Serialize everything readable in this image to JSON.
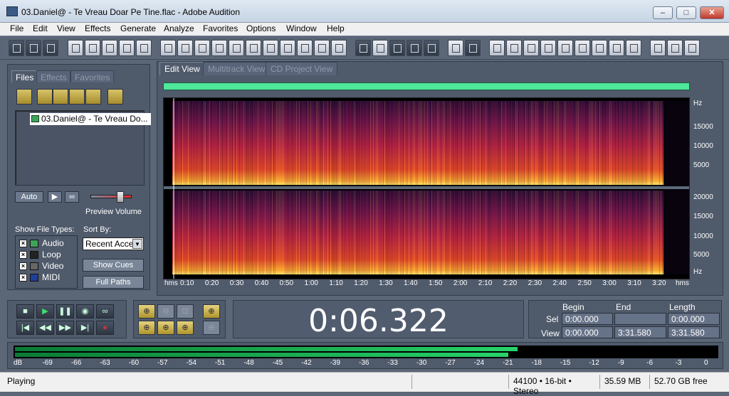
{
  "window": {
    "title": "03.Daniel@ - Te Vreau Doar Pe Tine.flac - Adobe Audition",
    "min": "–",
    "max": "□",
    "close": "✕"
  },
  "menu": [
    "File",
    "Edit",
    "View",
    "Effects",
    "Generate",
    "Analyze",
    "Favorites",
    "Options",
    "Window",
    "Help"
  ],
  "left_panel": {
    "tabs": [
      "Files",
      "Effects",
      "Favorites"
    ],
    "file_item": "03.Daniel@ - Te Vreau Do...",
    "auto_label": "Auto",
    "play_label": "▶",
    "loop_label": "∞",
    "preview_volume_label": "Preview Volume",
    "preview_volume_level": 0.78,
    "show_file_types_label": "Show File Types:",
    "sort_by_label": "Sort By:",
    "sort_value": "Recent Acce",
    "file_types": [
      "Audio",
      "Loop",
      "Video",
      "MIDI"
    ],
    "show_cues_button": "Show Cues",
    "full_paths_button": "Full Paths"
  },
  "editor": {
    "view_tabs": [
      "Edit View",
      "Multitrack View",
      "CD Project View"
    ],
    "y_top": [
      "Hz",
      "15000",
      "10000",
      "5000"
    ],
    "y_bottom": [
      "20000",
      "15000",
      "10000",
      "5000",
      "Hz"
    ],
    "x_ticks": [
      "hms",
      "0:10",
      "0:20",
      "0:30",
      "0:40",
      "0:50",
      "1:00",
      "1:10",
      "1:20",
      "1:30",
      "1:40",
      "1:50",
      "2:00",
      "2:10",
      "2:20",
      "2:30",
      "2:40",
      "2:50",
      "3:00",
      "3:10",
      "3:20",
      "hms"
    ]
  },
  "time_display": "0:06.322",
  "selection": {
    "headers": [
      "Begin",
      "End",
      "Length"
    ],
    "sel_label": "Sel",
    "view_label": "View",
    "sel": [
      "0:00.000",
      "",
      "0:00.000"
    ],
    "view": [
      "0:00.000",
      "3:31.580",
      "3:31.580"
    ]
  },
  "level_meter": {
    "ticks": [
      "dB",
      "-69",
      "-66",
      "-63",
      "-60",
      "-57",
      "-54",
      "-51",
      "-48",
      "-45",
      "-42",
      "-39",
      "-36",
      "-33",
      "-30",
      "-27",
      "-24",
      "-21",
      "-18",
      "-15",
      "-12",
      "-9",
      "-6",
      "-3",
      "0"
    ],
    "left_level_db": -20,
    "right_level_db": -21
  },
  "status": {
    "state": "Playing",
    "format": "44100 • 16-bit • Stereo",
    "size": "35.59 MB",
    "free": "52.70 GB free"
  }
}
